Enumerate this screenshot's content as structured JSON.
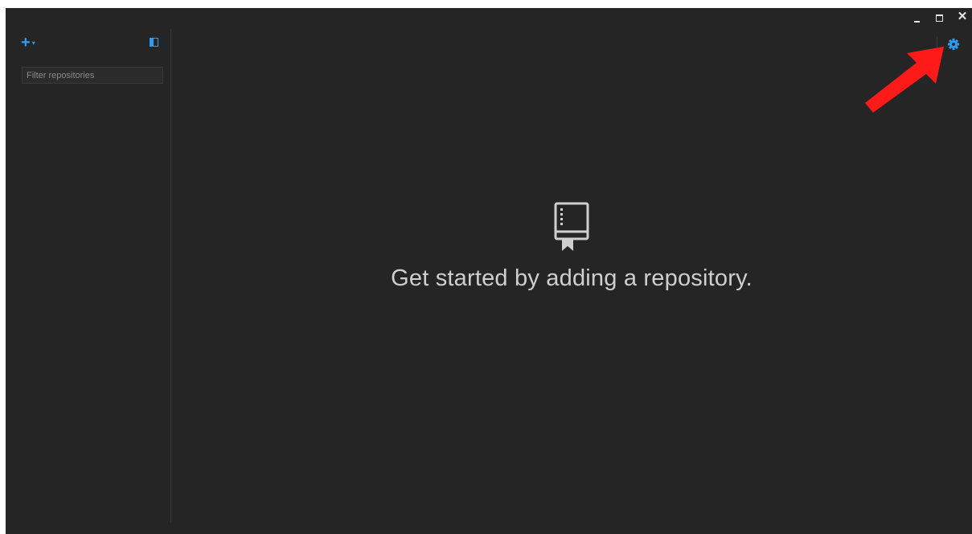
{
  "sidebar": {
    "add_label": "+",
    "add_caret": "▾",
    "filter": {
      "placeholder": "Filter repositories",
      "value": ""
    }
  },
  "main": {
    "empty_message": "Get started by adding a repository."
  },
  "icons": {
    "add": "plus-icon",
    "toggle": "sidebar-toggle-icon",
    "settings": "gear-icon",
    "repo": "repository-book-icon",
    "annotation": "red-arrow-annotation"
  },
  "colors": {
    "background": "#252525",
    "accent": "#2f9cf4",
    "text": "#cfcfcf",
    "annotation": "#ff0000"
  }
}
